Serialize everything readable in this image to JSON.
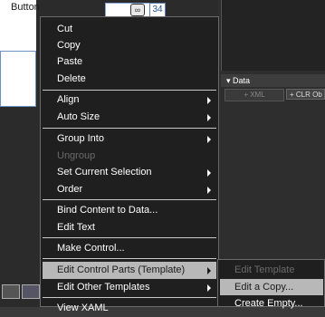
{
  "canvas": {
    "element_label": "Button",
    "ruler_value": "34"
  },
  "data_panel": {
    "header": "Data",
    "xml_button": "+ XML",
    "clr_button": "+ CLR Ob"
  },
  "context_menu": {
    "items": [
      {
        "label": "Cut",
        "submenu": false,
        "disabled": false
      },
      {
        "label": "Copy",
        "submenu": false,
        "disabled": false
      },
      {
        "label": "Paste",
        "submenu": false,
        "disabled": false
      },
      {
        "label": "Delete",
        "submenu": false,
        "disabled": false
      },
      {
        "label": "Align",
        "submenu": true,
        "disabled": false
      },
      {
        "label": "Auto Size",
        "submenu": true,
        "disabled": false
      },
      {
        "label": "Group Into",
        "submenu": true,
        "disabled": false
      },
      {
        "label": "Ungroup",
        "submenu": false,
        "disabled": true
      },
      {
        "label": "Set Current Selection",
        "submenu": true,
        "disabled": false
      },
      {
        "label": "Order",
        "submenu": true,
        "disabled": false
      },
      {
        "label": "Bind Content to Data...",
        "submenu": false,
        "disabled": false
      },
      {
        "label": "Edit Text",
        "submenu": false,
        "disabled": false
      },
      {
        "label": "Make Control...",
        "submenu": false,
        "disabled": false
      },
      {
        "label": "Edit Control Parts (Template)",
        "submenu": true,
        "disabled": false,
        "highlighted": true
      },
      {
        "label": "Edit Other Templates",
        "submenu": true,
        "disabled": false
      },
      {
        "label": "View XAML",
        "submenu": false,
        "disabled": false
      }
    ]
  },
  "submenu": {
    "items": [
      {
        "label": "Edit Template",
        "disabled": true
      },
      {
        "label": "Edit a Copy...",
        "highlighted": true
      },
      {
        "label": "Create Empty..."
      }
    ]
  }
}
